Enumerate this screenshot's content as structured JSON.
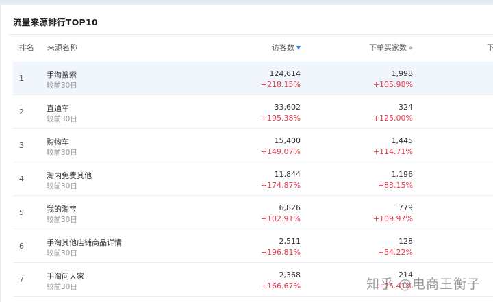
{
  "title": "流量来源排行TOP10",
  "columns": {
    "rank": "排名",
    "source": "来源名称",
    "visitors": "访客数",
    "buyers": "下单买家数",
    "next": "下"
  },
  "sort": {
    "visitors_icon": "sort-desc-icon",
    "buyers_icon": "sort-icon"
  },
  "rows": [
    {
      "rank": "1",
      "name": "手淘搜索",
      "compare": "较前30日",
      "visitors": "124,614",
      "visitors_change": "+218.15%",
      "buyers": "1,998",
      "buyers_change": "+105.98%"
    },
    {
      "rank": "2",
      "name": "直通车",
      "compare": "较前30日",
      "visitors": "33,602",
      "visitors_change": "+195.38%",
      "buyers": "324",
      "buyers_change": "+125.00%"
    },
    {
      "rank": "3",
      "name": "购物车",
      "compare": "较前30日",
      "visitors": "15,400",
      "visitors_change": "+149.07%",
      "buyers": "1,445",
      "buyers_change": "+114.71%"
    },
    {
      "rank": "4",
      "name": "淘内免费其他",
      "compare": "较前30日",
      "visitors": "11,844",
      "visitors_change": "+174.87%",
      "buyers": "1,196",
      "buyers_change": "+83.15%"
    },
    {
      "rank": "5",
      "name": "我的淘宝",
      "compare": "较前30日",
      "visitors": "6,826",
      "visitors_change": "+102.91%",
      "buyers": "779",
      "buyers_change": "+109.97%"
    },
    {
      "rank": "6",
      "name": "手淘其他店铺商品详情",
      "compare": "较前30日",
      "visitors": "2,511",
      "visitors_change": "+196.81%",
      "buyers": "128",
      "buyers_change": "+54.22%"
    },
    {
      "rank": "7",
      "name": "手淘问大家",
      "compare": "较前30日",
      "visitors": "2,368",
      "visitors_change": "+166.67%",
      "buyers": "214",
      "buyers_change": "+75.41%"
    }
  ],
  "watermark": "知乎 @电商王衡子",
  "colors": {
    "increase": "#e8394b",
    "highlight_row": "#f1f6fd",
    "sort_active": "#2a85e0"
  }
}
